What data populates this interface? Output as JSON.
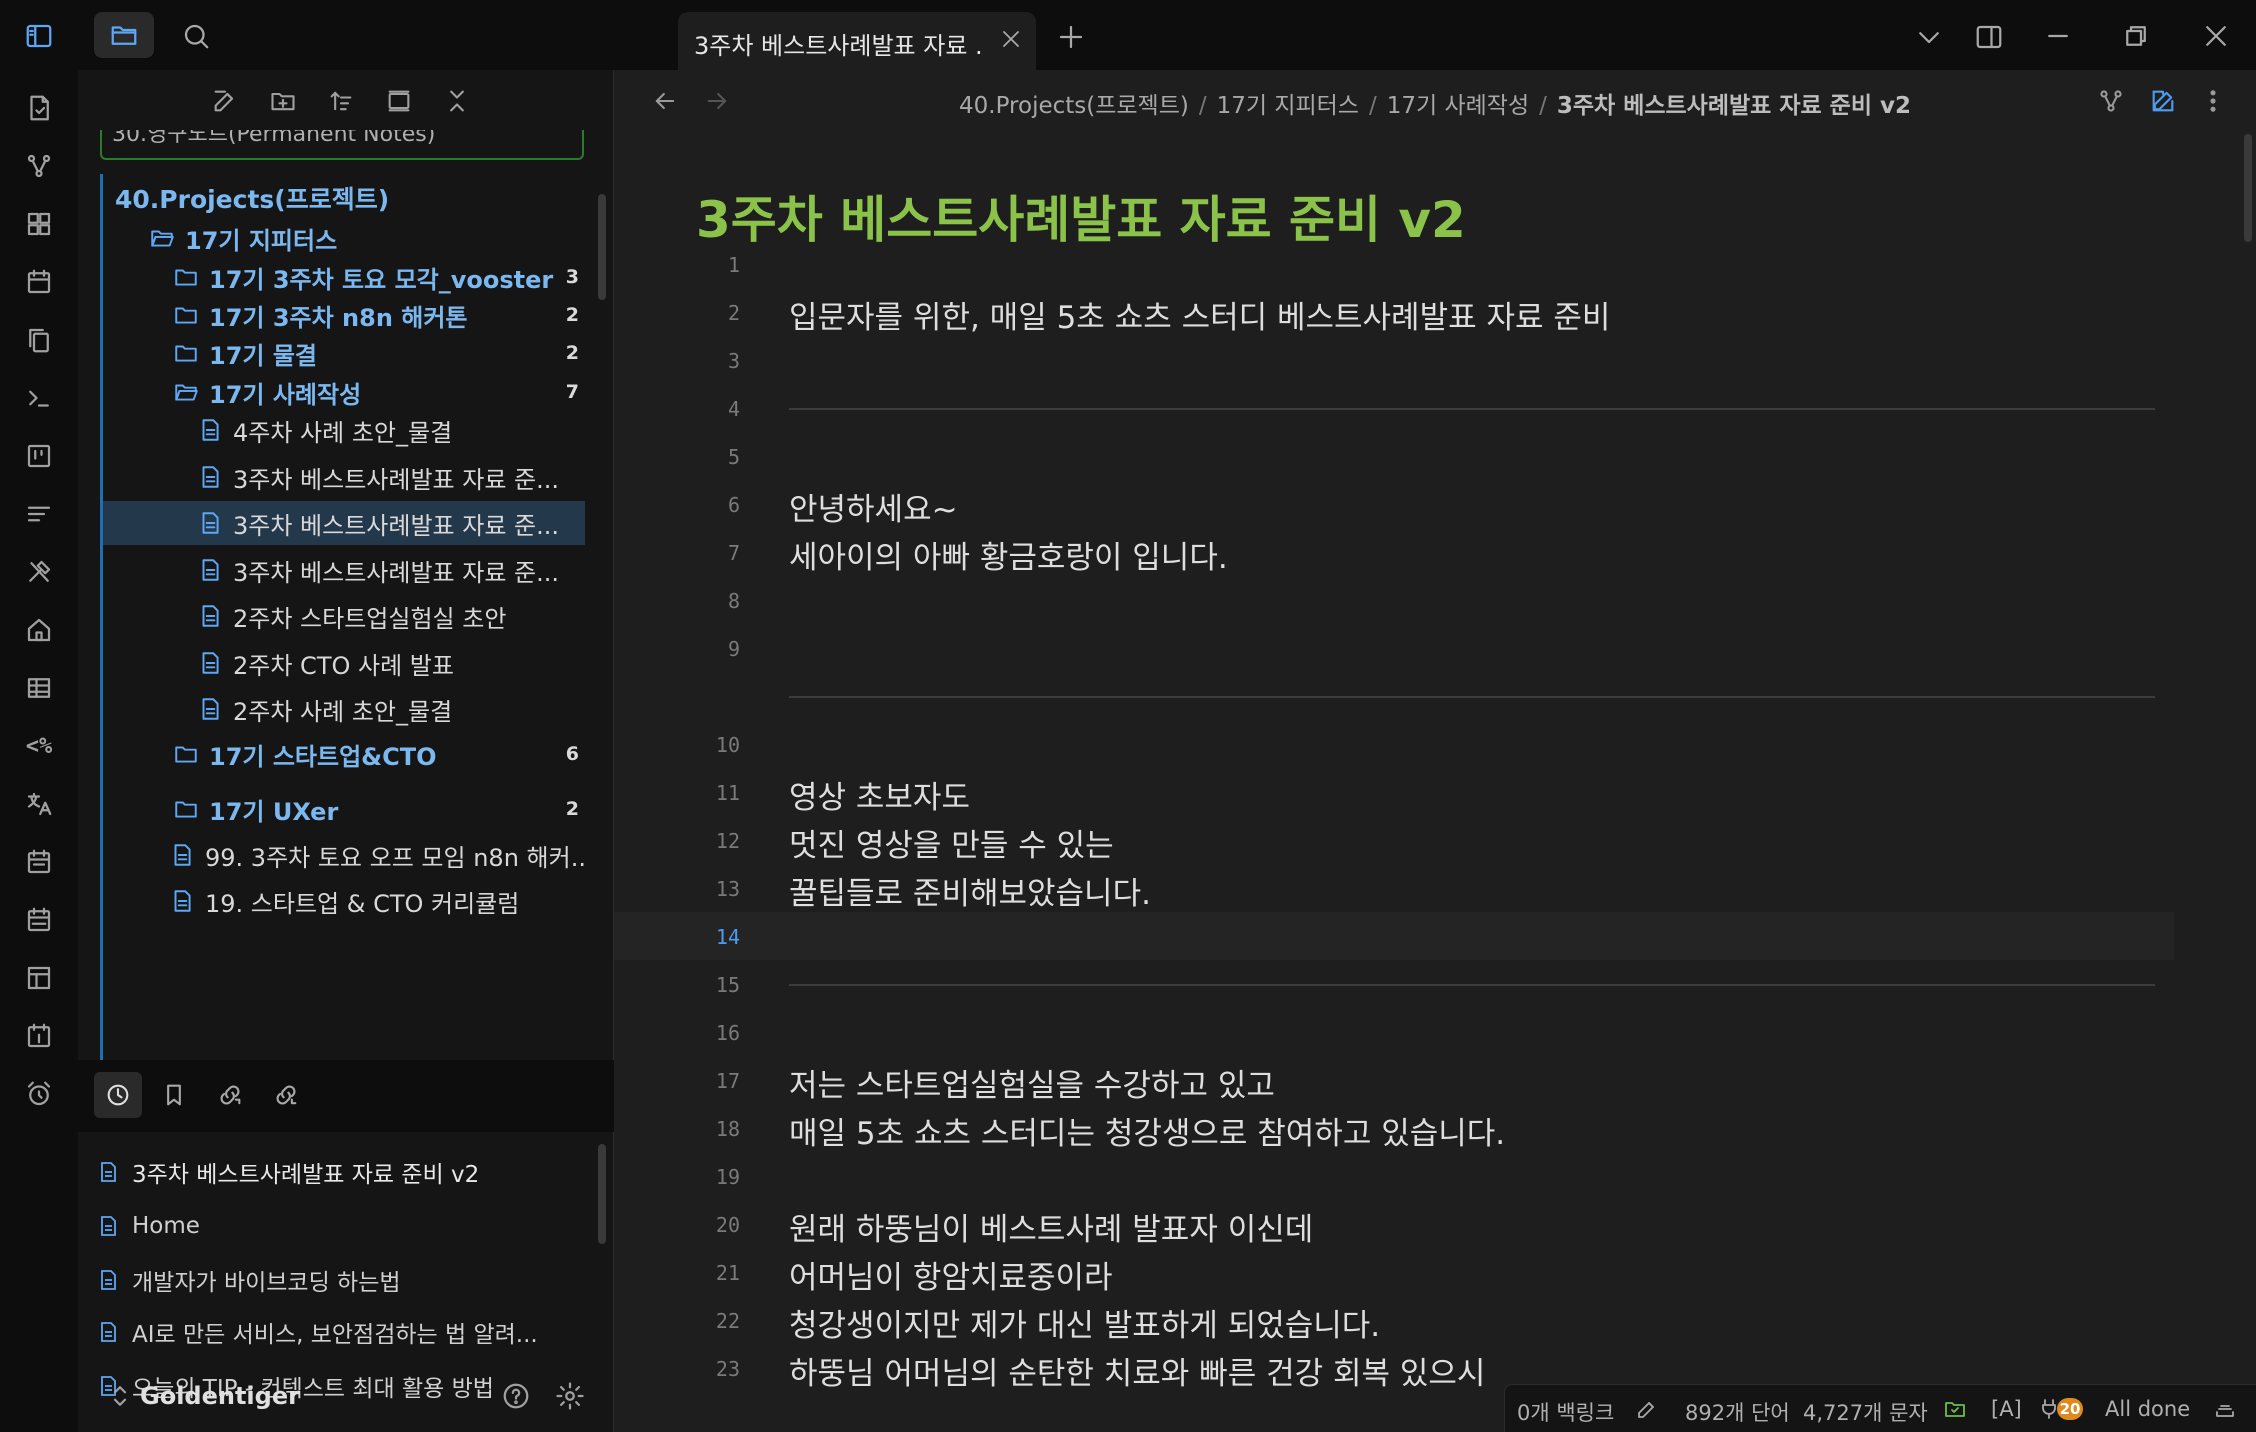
{
  "tab": {
    "title": "3주차 베스트사례발표 자료 ..."
  },
  "breadcrumb": [
    "40.Projects(프로젝트)",
    "17기 지피터스",
    "17기 사례작성",
    "3주차 베스트사례발표 자료 준비 v2"
  ],
  "sidebar": {
    "stub_label": "30.영구노트(Permanent Notes)",
    "root": "40.Projects(프로젝트)",
    "tree": [
      {
        "label": "17기 지피터스",
        "type": "folder-open"
      },
      {
        "label": "17기 3주차 토요 모각_vooster",
        "type": "folder",
        "count": "3"
      },
      {
        "label": "17기 3주차 n8n 해커톤",
        "type": "folder",
        "count": "2"
      },
      {
        "label": "17기 물결",
        "type": "folder",
        "count": "2"
      },
      {
        "label": "17기 사례작성",
        "type": "folder-open",
        "count": "7"
      },
      {
        "label": "4주차 사례 초안_물결",
        "type": "file"
      },
      {
        "label": "3주차 베스트사례발표 자료 준...",
        "type": "file"
      },
      {
        "label": "3주차 베스트사례발표 자료 준...",
        "type": "file",
        "active": true
      },
      {
        "label": "3주차 베스트사례발표 자료 준...",
        "type": "file"
      },
      {
        "label": "2주차 스타트업실험실 초안",
        "type": "file"
      },
      {
        "label": "2주차 CTO 사례 발표",
        "type": "file"
      },
      {
        "label": "2주차 사례 초안_물결",
        "type": "file"
      },
      {
        "label": "17기 스타트업&CTO",
        "type": "folder",
        "count": "6"
      },
      {
        "label": "17기 UXer",
        "type": "folder",
        "count": "2"
      },
      {
        "label": "99. 3주차 토요 오프 모임 n8n 해커...",
        "type": "file"
      },
      {
        "label": "19. 스타트업 & CTO 커리큘럼",
        "type": "file"
      }
    ],
    "recent": [
      "3주차 베스트사례발표 자료 준비 v2",
      "Home",
      "개발자가 바이브코딩 하는법",
      "AI로 만든 서비스, 보안점검하는 법 알려...",
      "오늘의 TIP - 컨텍스트 최대 활용 방법"
    ],
    "vault_name": "Goldentiger"
  },
  "ribbon_icons": [
    "notes-icon",
    "graph-icon",
    "dashboard-icon",
    "calendar-icon",
    "copy-icon",
    "terminal-icon",
    "kanban-icon",
    "outline-icon",
    "tools-icon",
    "home-icon",
    "table-icon",
    "template-icon",
    "translate-icon",
    "calendar-month-icon",
    "calendar-week-icon",
    "layout-icon",
    "daily-note-icon",
    "alarm-icon"
  ],
  "ribbon_template_text": "<%",
  "editor": {
    "title": "3주차 베스트사례발표 자료 준비 v2",
    "current_line": 14,
    "lines": [
      {
        "n": "1",
        "text": ""
      },
      {
        "n": "2",
        "text": "입문자를 위한, 매일 5초 쇼츠 스터디 베스트사례발표 자료 준비"
      },
      {
        "n": "3",
        "text": ""
      },
      {
        "n": "4",
        "hr": true
      },
      {
        "n": "5",
        "text": ""
      },
      {
        "n": "6",
        "text": "안녕하세요~"
      },
      {
        "n": "7",
        "text": "세아이의 아빠 황금호랑이 입니다."
      },
      {
        "n": "8",
        "text": ""
      },
      {
        "n": "9",
        "text": ""
      },
      {
        "n": "",
        "hr": true
      },
      {
        "n": "10",
        "text": ""
      },
      {
        "n": "11",
        "text": "영상 초보자도"
      },
      {
        "n": "12",
        "text": "멋진 영상을 만들 수 있는"
      },
      {
        "n": "13",
        "text": "꿀팁들로 준비해보았습니다."
      },
      {
        "n": "14",
        "text": ""
      },
      {
        "n": "15",
        "hr": true
      },
      {
        "n": "16",
        "text": ""
      },
      {
        "n": "17",
        "text": "저는 스타트업실험실을 수강하고 있고"
      },
      {
        "n": "18",
        "text": "매일 5초 쇼츠 스터디는 청강생으로 참여하고 있습니다."
      },
      {
        "n": "19",
        "text": ""
      },
      {
        "n": "20",
        "text": "원래 하뚱님이 베스트사례 발표자 이신데"
      },
      {
        "n": "21",
        "text": "어머님이 항암치료중이라"
      },
      {
        "n": "22",
        "text": "청강생이지만 제가 대신 발표하게 되었습니다."
      },
      {
        "n": "23",
        "text": "하뚱님 어머님의 순탄한 치료와 빠른 건강 회복 있으시"
      }
    ]
  },
  "status": {
    "backlinks": "0개 백링크",
    "words": "892개 단어",
    "chars": "4,727개 문자",
    "mode": "[A]",
    "plugin_badge": "20",
    "sync": "All done"
  }
}
